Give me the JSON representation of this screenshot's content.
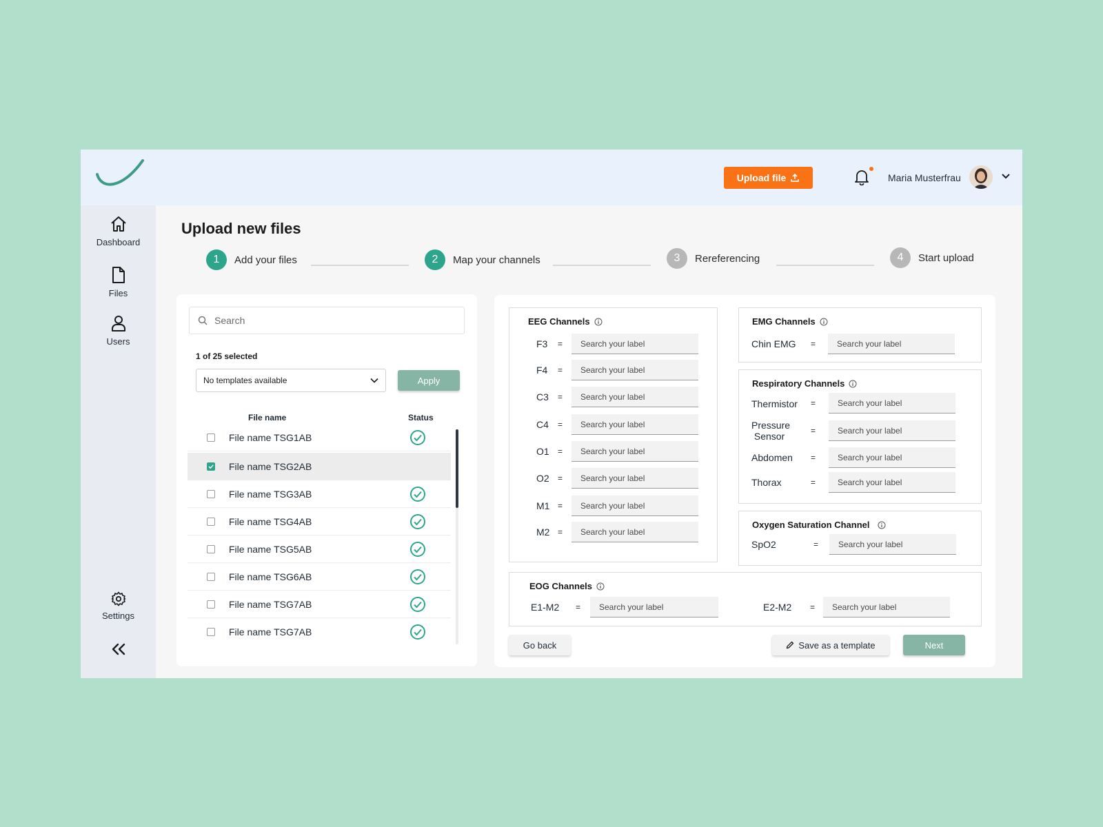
{
  "header": {
    "upload_label": "Upload file",
    "user_name": "Maria Musterfrau"
  },
  "sidebar": {
    "items": [
      {
        "label": "Dashboard",
        "icon": "home-icon"
      },
      {
        "label": "Files",
        "icon": "file-icon"
      },
      {
        "label": "Users",
        "icon": "user-icon"
      }
    ],
    "settings_label": "Settings",
    "collapse_icon": "double-chevron-left-icon"
  },
  "page_title": "Upload new files",
  "stepper": {
    "steps": [
      {
        "num": "1",
        "label": "Add your files",
        "state": "active"
      },
      {
        "num": "2",
        "label": "Map your channels",
        "state": "active"
      },
      {
        "num": "3",
        "label": "Rereferencing",
        "state": "inactive"
      },
      {
        "num": "4",
        "label": "Start upload",
        "state": "inactive"
      }
    ]
  },
  "files": {
    "search_placeholder": "Search",
    "selected_count": "1 of 25 selected",
    "template_select": "No templates available",
    "apply_label": "Apply",
    "col_filename": "File name",
    "col_status": "Status",
    "rows": [
      {
        "name": "File name TSG1AB",
        "checked": false,
        "status": "check"
      },
      {
        "name": "File name TSG2AB",
        "checked": true,
        "status": ""
      },
      {
        "name": "File name TSG3AB",
        "checked": false,
        "status": "check"
      },
      {
        "name": "File name TSG4AB",
        "checked": false,
        "status": "check"
      },
      {
        "name": "File name TSG5AB",
        "checked": false,
        "status": "check"
      },
      {
        "name": "File name TSG6AB",
        "checked": false,
        "status": "check"
      },
      {
        "name": "File name TSG7AB",
        "checked": false,
        "status": "check"
      },
      {
        "name": "File name TSG7AB",
        "checked": false,
        "status": "check"
      }
    ]
  },
  "channels": {
    "input_placeholder": "Search your label",
    "equals": "=",
    "eeg": {
      "title": "EEG Channels",
      "labels": [
        "F3",
        "F4",
        "C3",
        "C4",
        "O1",
        "O2",
        "M1",
        "M2"
      ]
    },
    "emg": {
      "title": "EMG Channels",
      "labels": [
        "Chin EMG"
      ]
    },
    "respiratory": {
      "title": "Respiratory Channels",
      "labels": [
        "Thermistor",
        "Pressure \n Sensor",
        "Abdomen",
        "Thorax"
      ]
    },
    "oxygen": {
      "title": "Oxygen Saturation Channel",
      "labels": [
        "SpO2"
      ]
    },
    "eog": {
      "title": "EOG Channels",
      "labels": [
        "E1-M2",
        "E2-M2"
      ]
    }
  },
  "actions": {
    "go_back": "Go back",
    "save_template": "Save as a template",
    "next": "Next"
  },
  "colors": {
    "accent": "#2da58c",
    "brand_orange": "#f97316",
    "muted_green": "#86b5a6"
  }
}
